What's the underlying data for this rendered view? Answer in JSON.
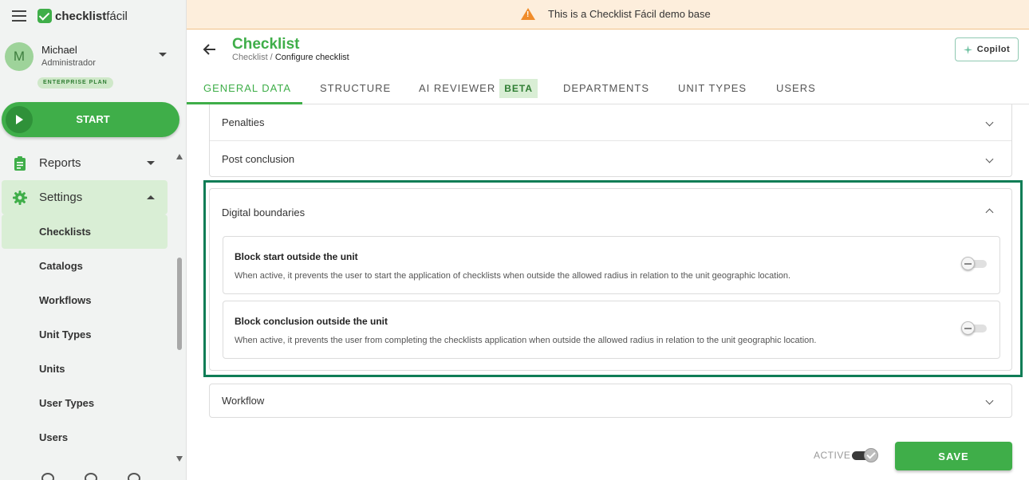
{
  "sidebar": {
    "logo": {
      "bold": "checklist",
      "light": "fácil"
    },
    "user": {
      "initial": "M",
      "name": "Michael",
      "role": "Administrador",
      "plan": "ENTERPRISE PLAN"
    },
    "start_label": "START",
    "nav": {
      "reports": "Reports",
      "settings": "Settings",
      "sub_items": [
        "Checklists",
        "Catalogs",
        "Workflows",
        "Unit Types",
        "Units",
        "User Types",
        "Users"
      ]
    }
  },
  "banner": {
    "text": "This is a Checklist Fácil demo base"
  },
  "header": {
    "title": "Checklist",
    "breadcrumb_parent": "Checklist /",
    "breadcrumb_current": "Configure checklist",
    "copilot_label": "Copilot"
  },
  "tabs": {
    "general_data": "GENERAL DATA",
    "structure": "STRUCTURE",
    "ai_reviewer": "AI REVIEWER",
    "beta": "BETA",
    "departments": "DEPARTMENTS",
    "unit_types": "UNIT TYPES",
    "users": "USERS"
  },
  "panels": {
    "penalties": "Penalties",
    "post_conclusion": "Post conclusion",
    "digital_boundaries": {
      "title": "Digital boundaries",
      "options": [
        {
          "title": "Block start outside the unit",
          "description": "When active, it prevents the user to start the application of checklists when outside the allowed radius in relation to the unit geographic location.",
          "enabled": false
        },
        {
          "title": "Block conclusion outside the unit",
          "description": "When active, it prevents the user from completing the checklists application when outside the allowed radius in relation to the unit geographic location.",
          "enabled": false
        }
      ]
    },
    "workflow": "Workflow"
  },
  "footer": {
    "active_label": "ACTIVE",
    "active_enabled": true,
    "save_label": "SAVE"
  },
  "colors": {
    "brand_green": "#3fae49",
    "highlight_border": "#0f7d56",
    "banner_bg": "#fdeedc",
    "warning": "#f08c2a"
  }
}
